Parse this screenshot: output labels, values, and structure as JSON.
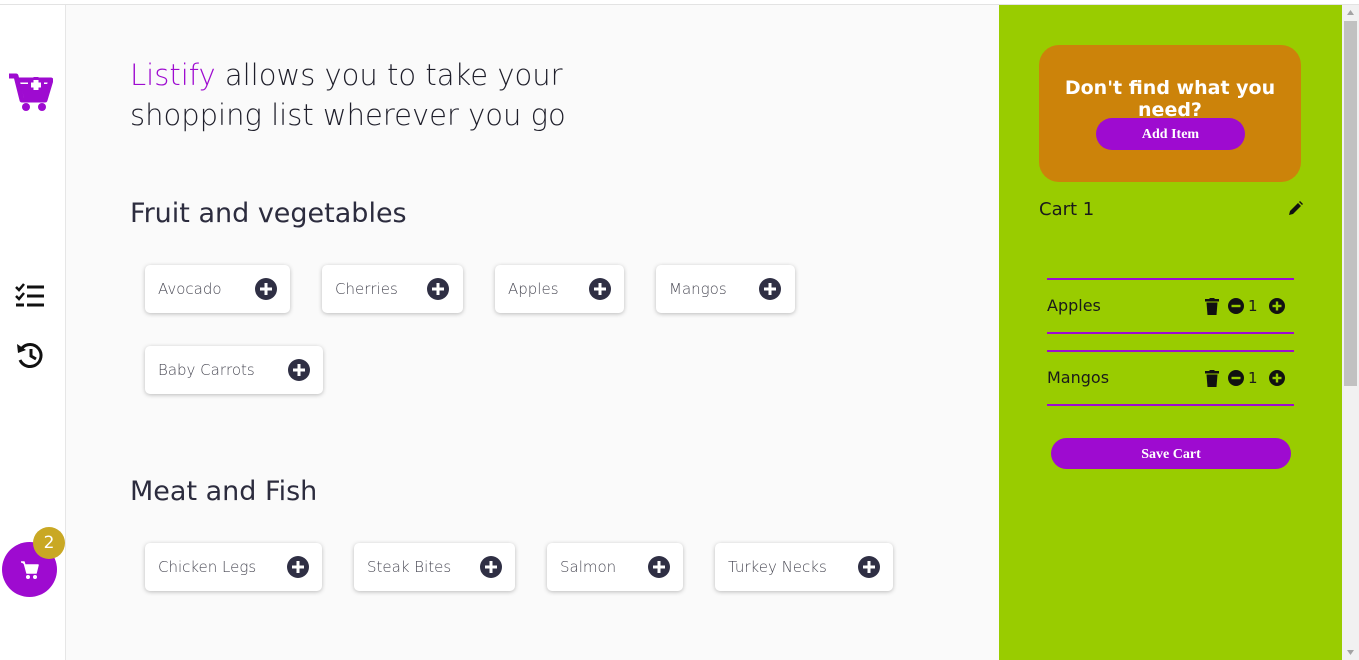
{
  "headline": {
    "brand": "Listify",
    "rest": " allows you to take your shopping list wherever you go"
  },
  "sections": [
    {
      "title": "Fruit and vegetables"
    },
    {
      "title": "Meat and Fish"
    }
  ],
  "products": {
    "fruit": [
      "Avocado",
      "Cherries",
      "Apples",
      "Mangos",
      "Baby Carrots"
    ],
    "meat": [
      "Chicken Legs",
      "Steak Bites",
      "Salmon",
      "Turkey Necks"
    ]
  },
  "cart_badge": "2",
  "panel": {
    "promo_text": "Don't find what you need?",
    "add_item_label": "Add Item",
    "cart_name": "Cart 1",
    "items": [
      {
        "name": "Apples",
        "qty": "1"
      },
      {
        "name": "Mangos",
        "qty": "1"
      }
    ],
    "save_label": "Save Cart"
  },
  "colors": {
    "accent": "#9e0bd0",
    "panel": "#99cc00",
    "promo": "#cc830a",
    "badge": "#c9a824"
  },
  "icons": [
    "add-to-cart-logo-icon",
    "checklist-icon",
    "history-icon",
    "cart-icon",
    "plus-circle-icon",
    "pencil-icon",
    "trash-icon",
    "minus-circle-icon"
  ]
}
